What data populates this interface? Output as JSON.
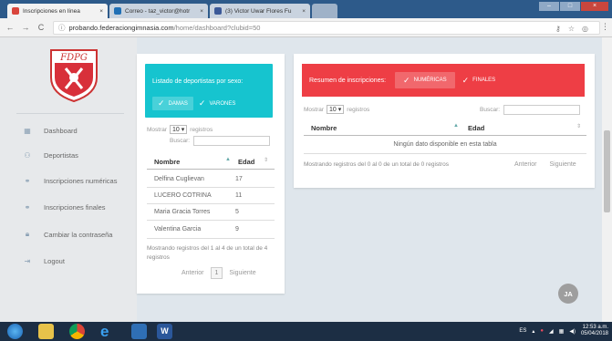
{
  "browser": {
    "tabs": [
      {
        "title": "Inscripciones en línea",
        "close": "×",
        "active": true,
        "color": "#d9453c"
      },
      {
        "title": "Correo - taz_victor@hotr",
        "close": "×",
        "active": false,
        "color": "#1f6fb5"
      },
      {
        "title": "(3) Victor Uwar Flores Fu",
        "close": "×",
        "active": false,
        "color": "#3b5998"
      }
    ],
    "url_prefix": "probando.federaciongimnasia.com",
    "url_path": "/home/dashboard?clubid=50"
  },
  "brand": {
    "logo_text": "FDPG"
  },
  "sidebar": {
    "items": [
      {
        "label": "Dashboard",
        "icon": "grid-icon"
      },
      {
        "label": "Deportistas",
        "icon": "users-icon"
      },
      {
        "label": "Inscripciones numéricas",
        "icon": "group-icon"
      },
      {
        "label": "Inscripciones finales",
        "icon": "group-icon"
      },
      {
        "label": "Cambiar la contraseña",
        "icon": "lock-icon"
      },
      {
        "label": "Logout",
        "icon": "logout-icon"
      }
    ]
  },
  "card_sex": {
    "title": "Listado de deportistas por sexo:",
    "filter_damas": "DAMAS",
    "filter_varones": "VARONES",
    "show_label": "Mostrar",
    "page_size": "10",
    "records_label": "registros",
    "search_label": "Buscar:",
    "col_name": "Nombre",
    "col_age": "Edad",
    "rows": [
      {
        "name": "Delfina Cuglievan",
        "age": "17"
      },
      {
        "name": "LUCERO COTRINA",
        "age": "11"
      },
      {
        "name": "Maria Gracia Torres",
        "age": "5"
      },
      {
        "name": "Valentina Garcia",
        "age": "9"
      }
    ],
    "info": "Mostrando registros del 1 al 4 de un total de 4 registros",
    "prev": "Anterior",
    "page": "1",
    "next": "Siguiente"
  },
  "card_summary": {
    "title": "Resumen de inscripciones:",
    "tab_numericas": "NUMÉRICAS",
    "tab_finales": "FINALES",
    "show_label": "Mostrar",
    "page_size": "10",
    "records_label": "registros",
    "search_label": "Buscar:",
    "col_name": "Nombre",
    "col_age": "Edad",
    "empty": "Ningún dato disponible en esta tabla",
    "info": "Mostrando registros del 0 al 0 de un total de 0 registros",
    "prev": "Anterior",
    "next": "Siguiente"
  },
  "user": {
    "initials": "JA"
  },
  "taskbar": {
    "lang": "ES",
    "time": "12:53 a.m.",
    "date": "05/04/2018"
  },
  "colors": {
    "teal": "#16c4cf",
    "red": "#ee3e45"
  }
}
